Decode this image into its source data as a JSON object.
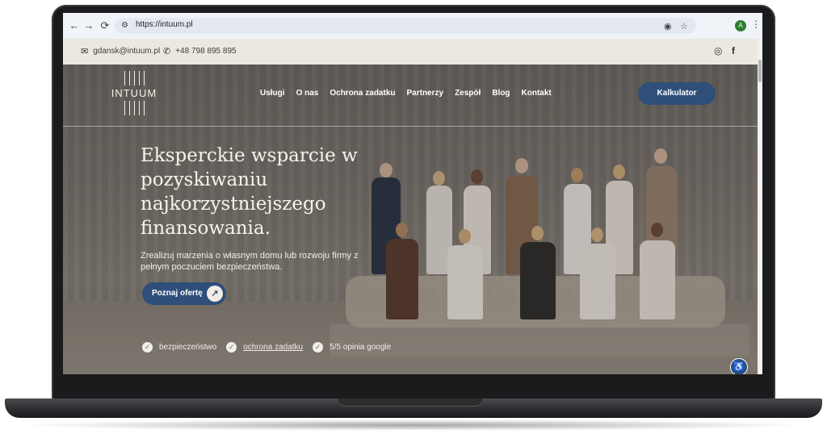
{
  "browser": {
    "url": "https://intuum.pl",
    "back_icon": "←",
    "forward_icon": "→",
    "reload_icon": "⟳",
    "profile_initial": "A"
  },
  "topbar": {
    "email": "gdansk@intuum.pl",
    "phone": "+48 798 895 895",
    "social": [
      "instagram",
      "facebook"
    ]
  },
  "header": {
    "logo": "INTUUM",
    "nav": [
      "Usługi",
      "O nas",
      "Ochrona zadatku",
      "Partnerzy",
      "Zespół",
      "Blog",
      "Kontakt"
    ],
    "cta": "Kalkulator"
  },
  "hero": {
    "headline": "Eksperckie wsparcie w pozyskiwaniu najkorzystniejszego finansowania.",
    "subtext": "Zrealizuj marzenia o własnym domu lub rozwoju firmy z pełnym poczuciem bezpieczeństwa.",
    "button": "Poznaj ofertę",
    "features": [
      "bezpieczeństwo",
      "ochrona zadatku",
      "5/5 opinia google"
    ]
  },
  "colors": {
    "accent": "#2f4f7a",
    "topbar_bg": "#ece8df"
  }
}
